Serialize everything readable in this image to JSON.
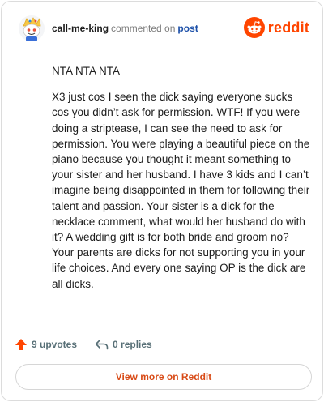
{
  "header": {
    "username": "call-me-king",
    "action": "commented on",
    "target": "post",
    "brand_name": "reddit"
  },
  "comment": {
    "paragraphs": [
      "NTA NTA NTA",
      "X3 just cos I seen the dick saying everyone sucks cos you didn’t ask for permission. WTF! If you were doing a striptease, I can see the need to ask for permission. You were playing a beautiful piece on the piano because you thought it meant something to your sister and her husband. I have 3 kids and I can’t imagine being disappointed in them for following their talent and passion. Your sister is a dick for the necklace comment, what would her husband do with it? A wedding gift is for both bride and groom no? Your parents are dicks for not supporting you in your life choices. And every one saying OP is the dick are all dicks."
    ]
  },
  "footer": {
    "upvotes": "9 upvotes",
    "replies": "0 replies"
  },
  "view_more_label": "View more on Reddit",
  "colors": {
    "brand": "#ff4500",
    "link": "#1b4fa8",
    "view_more": "#d84a16",
    "muted": "#576f76"
  },
  "icons": {
    "avatar": "snoo-avatar",
    "logo": "reddit-logo-icon",
    "upvote": "upvote-arrow-icon",
    "reply": "reply-arrow-icon"
  }
}
